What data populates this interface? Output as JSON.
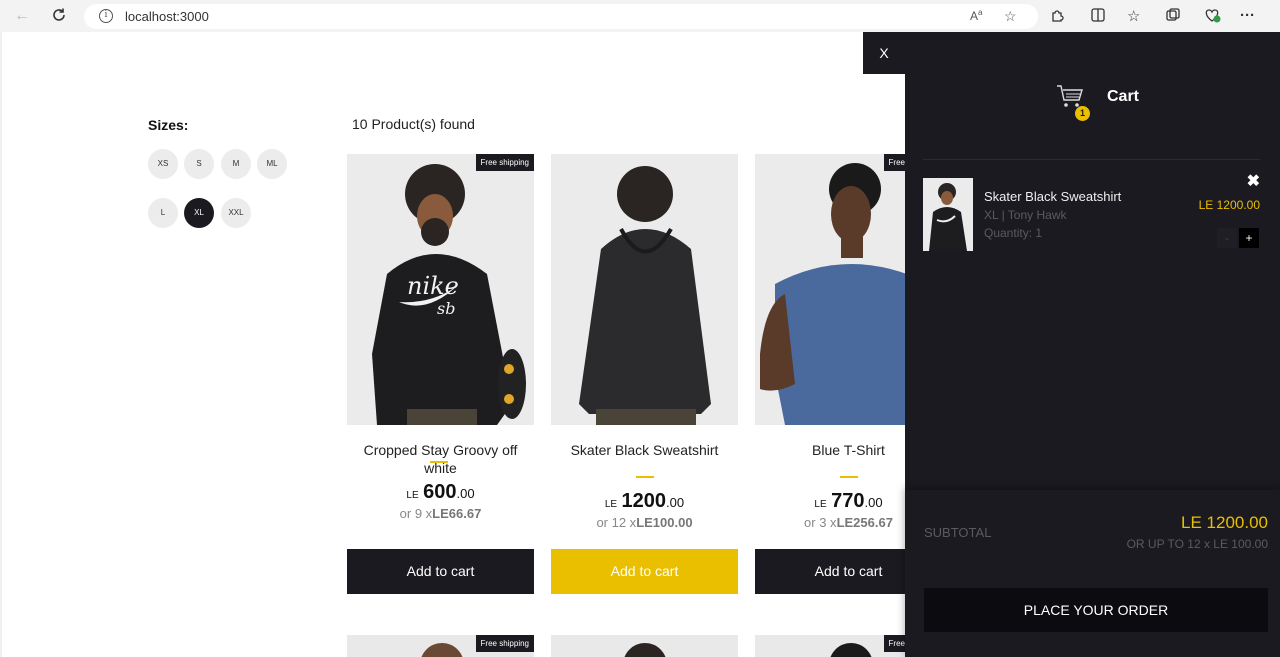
{
  "browser": {
    "url": "localhost:3000",
    "info_glyph": "i"
  },
  "filters": {
    "title": "Sizes:",
    "sizes": [
      "XS",
      "S",
      "M",
      "ML",
      "L",
      "XL",
      "XXL"
    ],
    "selected": "XL"
  },
  "products": {
    "found_text": "10 Product(s) found",
    "items": [
      {
        "title": "Cropped Stay Groovy off white",
        "badge": "Free shipping",
        "currency": "LE",
        "price_int": "600",
        "price_dec": ".00",
        "installment_prefix": "or 9 x",
        "installment_value": "LE66.67",
        "button": "Add to cart"
      },
      {
        "title": "Skater Black Sweatshirt",
        "badge": "",
        "currency": "LE",
        "price_int": "1200",
        "price_dec": ".00",
        "installment_prefix": "or 12 x",
        "installment_value": "LE100.00",
        "button": "Add to cart"
      },
      {
        "title": "Blue T-Shirt",
        "badge": "Free shipping",
        "currency": "LE",
        "price_int": "770",
        "price_dec": ".00",
        "installment_prefix": "or 3 x",
        "installment_value": "LE256.67",
        "button": "Add to cart"
      }
    ],
    "next_row_badges": [
      "Free shipping",
      "",
      "Free shipping"
    ]
  },
  "cart": {
    "close_label": "X",
    "title": "Cart",
    "badge_count": "1",
    "item": {
      "name": "Skater Black Sweatshirt",
      "desc": "XL | Tony Hawk",
      "quantity": "Quantity: 1",
      "price": "LE 1200.00",
      "remove": "✖",
      "minus": "-",
      "plus": "+"
    },
    "subtotal_label": "SUBTOTAL",
    "subtotal_value": "LE 1200.00",
    "installments": "OR UP TO 12 x LE 100.00",
    "order_button": "PLACE YOUR ORDER"
  },
  "colors": {
    "accent": "#eabf00",
    "dark": "#1b1a20"
  }
}
